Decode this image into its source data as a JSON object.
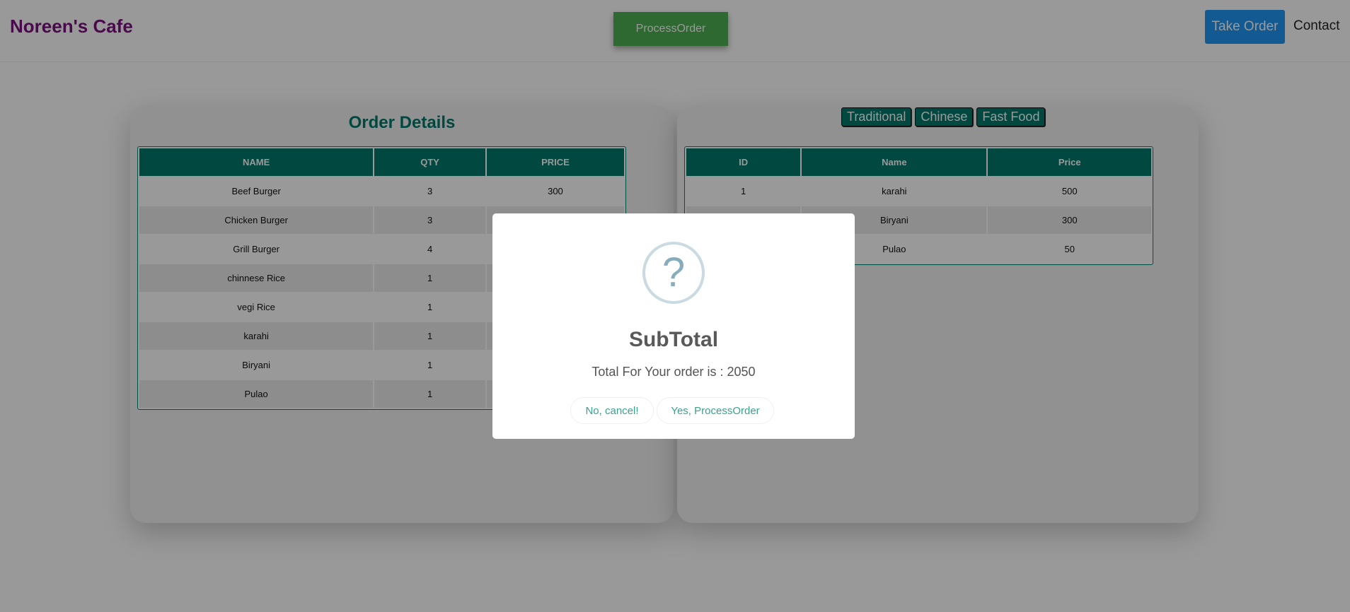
{
  "navbar": {
    "brand": "Noreen's Cafe",
    "process_order": "ProcessOrder",
    "take_order": "Take Order",
    "contact": "Contact"
  },
  "order_details": {
    "title": "Order Details",
    "columns": [
      "NAME",
      "QTY",
      "PRICE"
    ],
    "rows": [
      {
        "name": "Beef Burger",
        "qty": "3",
        "price": "300"
      },
      {
        "name": "Chicken Burger",
        "qty": "3",
        "price": ""
      },
      {
        "name": "Grill Burger",
        "qty": "4",
        "price": ""
      },
      {
        "name": "chinnese Rice",
        "qty": "1",
        "price": ""
      },
      {
        "name": "vegi Rice",
        "qty": "1",
        "price": ""
      },
      {
        "name": "karahi",
        "qty": "1",
        "price": ""
      },
      {
        "name": "Biryani",
        "qty": "1",
        "price": ""
      },
      {
        "name": "Pulao",
        "qty": "1",
        "price": ""
      }
    ]
  },
  "menu": {
    "tabs": [
      "Traditional",
      "Chinese",
      "Fast Food"
    ],
    "columns": [
      "ID",
      "Name",
      "Price"
    ],
    "rows": [
      {
        "id": "1",
        "name": "karahi",
        "price": "500"
      },
      {
        "id": "",
        "name": "Biryani",
        "price": "300"
      },
      {
        "id": "",
        "name": "Pulao",
        "price": "50"
      }
    ]
  },
  "modal": {
    "icon": "?",
    "title": "SubTotal",
    "text": "Total For Your order is : 2050",
    "cancel_label": "No, cancel!",
    "confirm_label": "Yes, ProcessOrder"
  },
  "colors": {
    "brand": "#7a0f7f",
    "accent_teal": "#00796b",
    "process_green": "#4caf50",
    "take_order_blue": "#2196f3",
    "modal_button_text": "#3aa28c"
  }
}
